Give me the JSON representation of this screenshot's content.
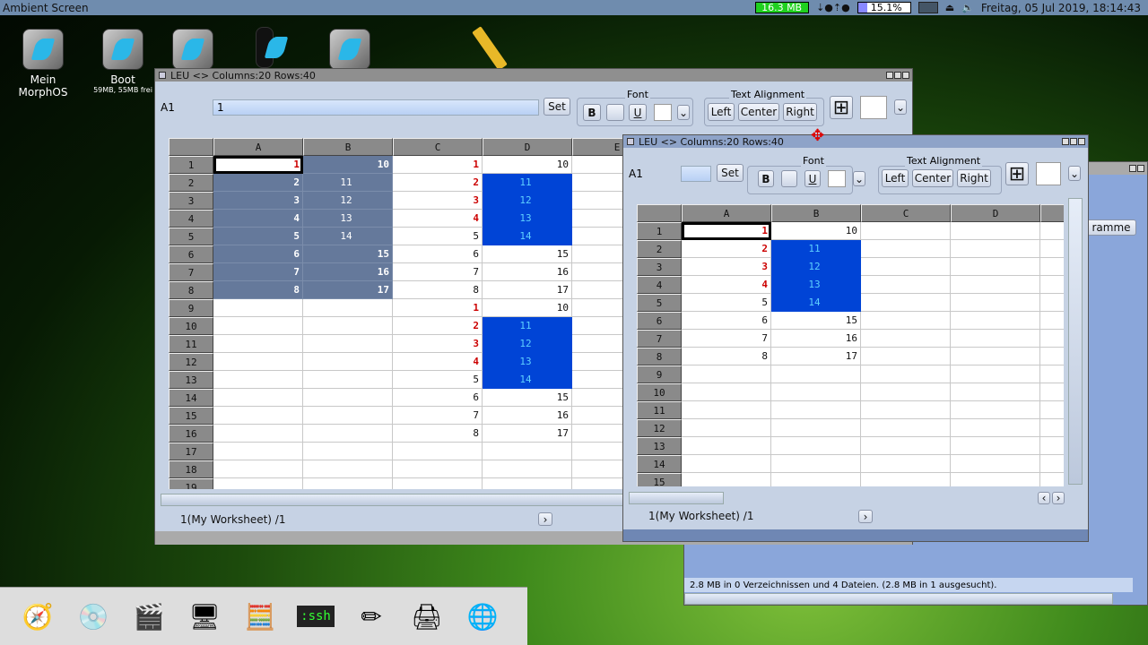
{
  "topbar": {
    "title": "Ambient Screen",
    "memory": "16.3 MB",
    "cpu": "15.1%",
    "datetime": "Freitag, 05 Jul 2019, 18:14:43"
  },
  "desktop_icons": [
    {
      "label": "Mein MorphOS",
      "sub": ""
    },
    {
      "label": "Boot",
      "sub": "59MB, 55MB frei"
    },
    {
      "label": "",
      "sub": ""
    },
    {
      "label": "",
      "sub": ""
    },
    {
      "label": "",
      "sub": ""
    }
  ],
  "left_window": {
    "title": "LEU <> Columns:20 Rows:40",
    "cell_ref": "A1",
    "cell_value": "1",
    "set_label": "Set",
    "font_label": "Font",
    "bold": "B",
    "underline": "U",
    "align_label": "Text Alignment",
    "left": "Left",
    "center": "Center",
    "right": "Right",
    "columns": [
      "A",
      "B",
      "C",
      "D",
      "E"
    ],
    "rows": [
      [
        {
          "v": "1",
          "k": "cur"
        },
        {
          "v": "10",
          "k": "sel"
        },
        {
          "v": "1",
          "k": "red"
        },
        {
          "v": "10",
          "k": ""
        },
        {
          "v": "",
          "k": ""
        }
      ],
      [
        {
          "v": "2",
          "k": "sel"
        },
        {
          "v": "11",
          "k": "selc"
        },
        {
          "v": "2",
          "k": "red"
        },
        {
          "v": "11",
          "k": "blue"
        },
        {
          "v": "",
          "k": ""
        }
      ],
      [
        {
          "v": "3",
          "k": "sel"
        },
        {
          "v": "12",
          "k": "selc"
        },
        {
          "v": "3",
          "k": "red"
        },
        {
          "v": "12",
          "k": "blue"
        },
        {
          "v": "",
          "k": ""
        }
      ],
      [
        {
          "v": "4",
          "k": "sel"
        },
        {
          "v": "13",
          "k": "selc"
        },
        {
          "v": "4",
          "k": "red"
        },
        {
          "v": "13",
          "k": "blue"
        },
        {
          "v": "",
          "k": ""
        }
      ],
      [
        {
          "v": "5",
          "k": "sel"
        },
        {
          "v": "14",
          "k": "selc"
        },
        {
          "v": "5",
          "k": ""
        },
        {
          "v": "14",
          "k": "blue"
        },
        {
          "v": "",
          "k": ""
        }
      ],
      [
        {
          "v": "6",
          "k": "sel"
        },
        {
          "v": "15",
          "k": "sel"
        },
        {
          "v": "6",
          "k": ""
        },
        {
          "v": "15",
          "k": ""
        },
        {
          "v": "",
          "k": ""
        }
      ],
      [
        {
          "v": "7",
          "k": "sel"
        },
        {
          "v": "16",
          "k": "sel"
        },
        {
          "v": "7",
          "k": ""
        },
        {
          "v": "16",
          "k": ""
        },
        {
          "v": "",
          "k": ""
        }
      ],
      [
        {
          "v": "8",
          "k": "sel"
        },
        {
          "v": "17",
          "k": "sel"
        },
        {
          "v": "8",
          "k": ""
        },
        {
          "v": "17",
          "k": ""
        },
        {
          "v": "",
          "k": ""
        }
      ],
      [
        {
          "v": "",
          "k": ""
        },
        {
          "v": "",
          "k": ""
        },
        {
          "v": "1",
          "k": "red"
        },
        {
          "v": "10",
          "k": ""
        },
        {
          "v": "",
          "k": ""
        }
      ],
      [
        {
          "v": "",
          "k": ""
        },
        {
          "v": "",
          "k": ""
        },
        {
          "v": "2",
          "k": "red"
        },
        {
          "v": "11",
          "k": "blue"
        },
        {
          "v": "",
          "k": ""
        }
      ],
      [
        {
          "v": "",
          "k": ""
        },
        {
          "v": "",
          "k": ""
        },
        {
          "v": "3",
          "k": "red"
        },
        {
          "v": "12",
          "k": "blue"
        },
        {
          "v": "",
          "k": ""
        }
      ],
      [
        {
          "v": "",
          "k": ""
        },
        {
          "v": "",
          "k": ""
        },
        {
          "v": "4",
          "k": "red"
        },
        {
          "v": "13",
          "k": "blue"
        },
        {
          "v": "",
          "k": ""
        }
      ],
      [
        {
          "v": "",
          "k": ""
        },
        {
          "v": "",
          "k": ""
        },
        {
          "v": "5",
          "k": ""
        },
        {
          "v": "14",
          "k": "blue"
        },
        {
          "v": "",
          "k": ""
        }
      ],
      [
        {
          "v": "",
          "k": ""
        },
        {
          "v": "",
          "k": ""
        },
        {
          "v": "6",
          "k": ""
        },
        {
          "v": "15",
          "k": ""
        },
        {
          "v": "",
          "k": ""
        }
      ],
      [
        {
          "v": "",
          "k": ""
        },
        {
          "v": "",
          "k": ""
        },
        {
          "v": "7",
          "k": ""
        },
        {
          "v": "16",
          "k": ""
        },
        {
          "v": "",
          "k": ""
        }
      ],
      [
        {
          "v": "",
          "k": ""
        },
        {
          "v": "",
          "k": ""
        },
        {
          "v": "8",
          "k": ""
        },
        {
          "v": "17",
          "k": ""
        },
        {
          "v": "",
          "k": ""
        }
      ],
      [],
      [],
      []
    ],
    "sheet_label": "1(My Worksheet) /1"
  },
  "right_window": {
    "title": "LEU <> Columns:20 Rows:40",
    "cell_ref": "A1",
    "cell_value": "",
    "set_label": "Set",
    "font_label": "Font",
    "bold": "B",
    "underline": "U",
    "align_label": "Text Alignment",
    "left": "Left",
    "center": "Center",
    "right": "Right",
    "columns": [
      "A",
      "B",
      "C",
      "D",
      ""
    ],
    "rows": [
      [
        {
          "v": "1",
          "k": "cur"
        },
        {
          "v": "10",
          "k": ""
        }
      ],
      [
        {
          "v": "2",
          "k": "red"
        },
        {
          "v": "11",
          "k": "blue"
        }
      ],
      [
        {
          "v": "3",
          "k": "red"
        },
        {
          "v": "12",
          "k": "blue"
        }
      ],
      [
        {
          "v": "4",
          "k": "red"
        },
        {
          "v": "13",
          "k": "blue"
        }
      ],
      [
        {
          "v": "5",
          "k": ""
        },
        {
          "v": "14",
          "k": "blue"
        }
      ],
      [
        {
          "v": "6",
          "k": ""
        },
        {
          "v": "15",
          "k": ""
        }
      ],
      [
        {
          "v": "7",
          "k": ""
        },
        {
          "v": "16",
          "k": ""
        }
      ],
      [
        {
          "v": "8",
          "k": ""
        },
        {
          "v": "17",
          "k": ""
        }
      ],
      [],
      [],
      [],
      [],
      [],
      [],
      []
    ],
    "sheet_label": "1(My Worksheet) /1"
  },
  "file_window": {
    "button_label": "ramme",
    "status": "2.8 MB in 0 Verzeichnissen und 4 Dateien. (2.8 MB in 1 ausgesucht)."
  },
  "dock": [
    {
      "icon": "compass-icon",
      "glyph": "🧭",
      "label": ""
    },
    {
      "icon": "disc-icon",
      "glyph": "💿",
      "label": ""
    },
    {
      "icon": "clapper-icon",
      "glyph": "🎬",
      "label": ""
    },
    {
      "icon": "monitor-icon",
      "glyph": "🖥",
      "label": ""
    },
    {
      "icon": "calculator-icon",
      "glyph": "🧮",
      "label": ""
    },
    {
      "icon": "ssh-terminal-icon",
      "glyph": "",
      "label": ":ssh"
    },
    {
      "icon": "pencil-icon",
      "glyph": "✏",
      "label": ""
    },
    {
      "icon": "printer-icon",
      "glyph": "🖨",
      "label": ""
    },
    {
      "icon": "globe-icon",
      "glyph": "🌐",
      "label": ""
    }
  ]
}
